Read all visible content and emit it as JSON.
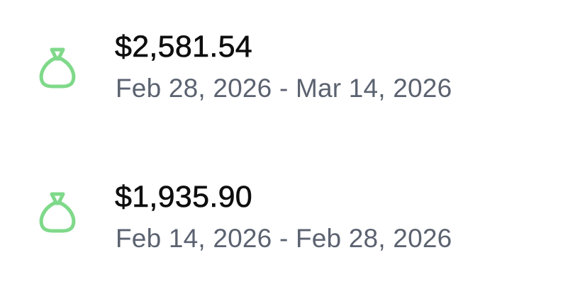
{
  "colors": {
    "icon": "#7fd98a",
    "amount": "#0e0e0e",
    "range": "#5b6270",
    "background": "#ffffff"
  },
  "payouts": [
    {
      "icon": "money-bag-icon",
      "amount": "$2,581.54",
      "range": "Feb 28, 2026 - Mar 14, 2026"
    },
    {
      "icon": "money-bag-icon",
      "amount": "$1,935.90",
      "range": "Feb 14, 2026 - Feb 28, 2026"
    }
  ]
}
